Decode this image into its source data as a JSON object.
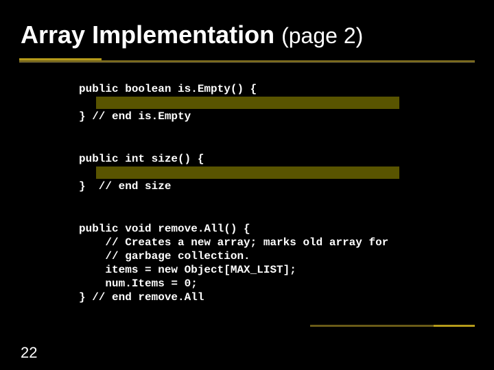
{
  "title_main": "Array Implementation ",
  "title_sub": "(page 2)",
  "code": {
    "isempty_sig": "public boolean is.Empty() {",
    "isempty_end": "} // end is.Empty",
    "size_sig": "public int size() {",
    "size_end": "}  // end size",
    "removeall_sig": "public void remove.All() {",
    "removeall_c1": "    // Creates a new array; marks old array for",
    "removeall_c2": "    // garbage collection.",
    "removeall_l1": "    items = new Object[MAX_LIST];",
    "removeall_l2": "    num.Items = 0;",
    "removeall_end": "} // end remove.All"
  },
  "page_number": "22"
}
